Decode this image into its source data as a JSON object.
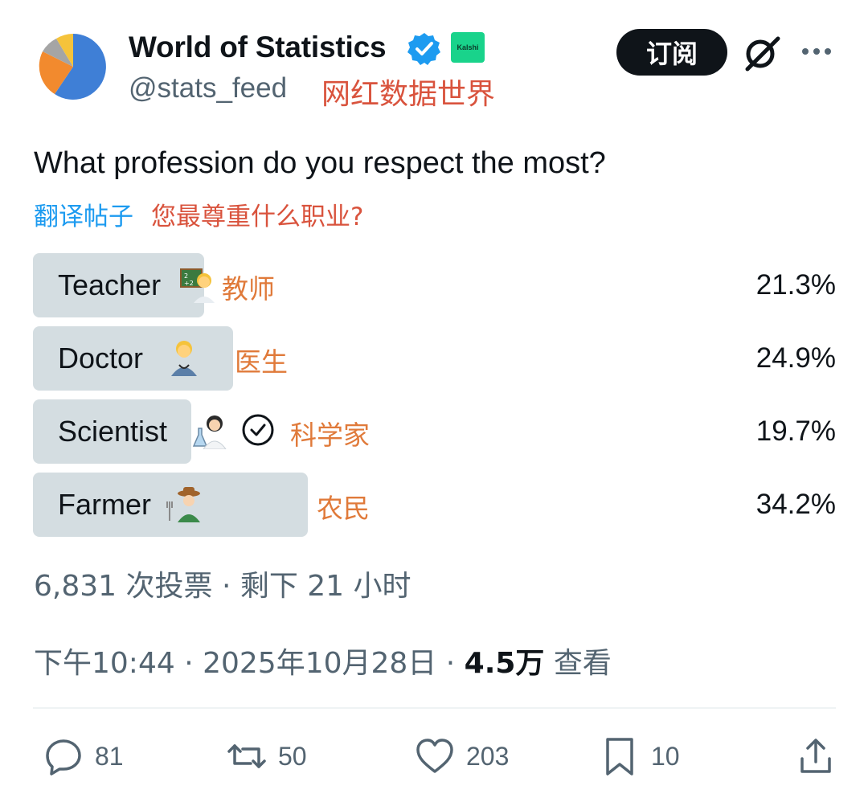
{
  "author": {
    "display_name": "World of Statistics",
    "handle": "@stats_feed",
    "handle_annotation": "网红数据世界",
    "affiliate_badge": "Kalshi",
    "verified_color": "#1d9bf0"
  },
  "header": {
    "subscribe_label": "订阅",
    "grok_icon": "grok-icon",
    "more_icon": "more-icon"
  },
  "post": {
    "question": "What profession do you respect the most?",
    "translate_label": "翻译帖子",
    "translation": "您最尊重什么职业?"
  },
  "poll": {
    "options": [
      {
        "label": "Teacher",
        "note": "教师",
        "percent": "21.3%",
        "value": 21.3
      },
      {
        "label": "Doctor",
        "note": "医生",
        "percent": "24.9%",
        "value": 24.9
      },
      {
        "label": "Scientist",
        "note": "科学家",
        "percent": "19.7%",
        "value": 19.7,
        "voted": true
      },
      {
        "label": "Farmer",
        "note": "农民",
        "percent": "34.2%",
        "value": 34.2
      }
    ],
    "meta": "6,831 次投票 · 剩下 21 小时"
  },
  "timestamp": {
    "time_date": "下午10:44 · 2025年10月28日 · ",
    "views_count": "4.5万",
    "views_label": " 查看"
  },
  "actions": {
    "replies": "81",
    "reposts": "50",
    "likes": "203",
    "bookmarks": "10"
  },
  "colors": {
    "text": "#0f1419",
    "secondary": "#536471",
    "bar": "#cfd9de",
    "annotation_red": "#d9533d",
    "annotation_orange": "#e07a3a",
    "link": "#1d9bf0"
  }
}
